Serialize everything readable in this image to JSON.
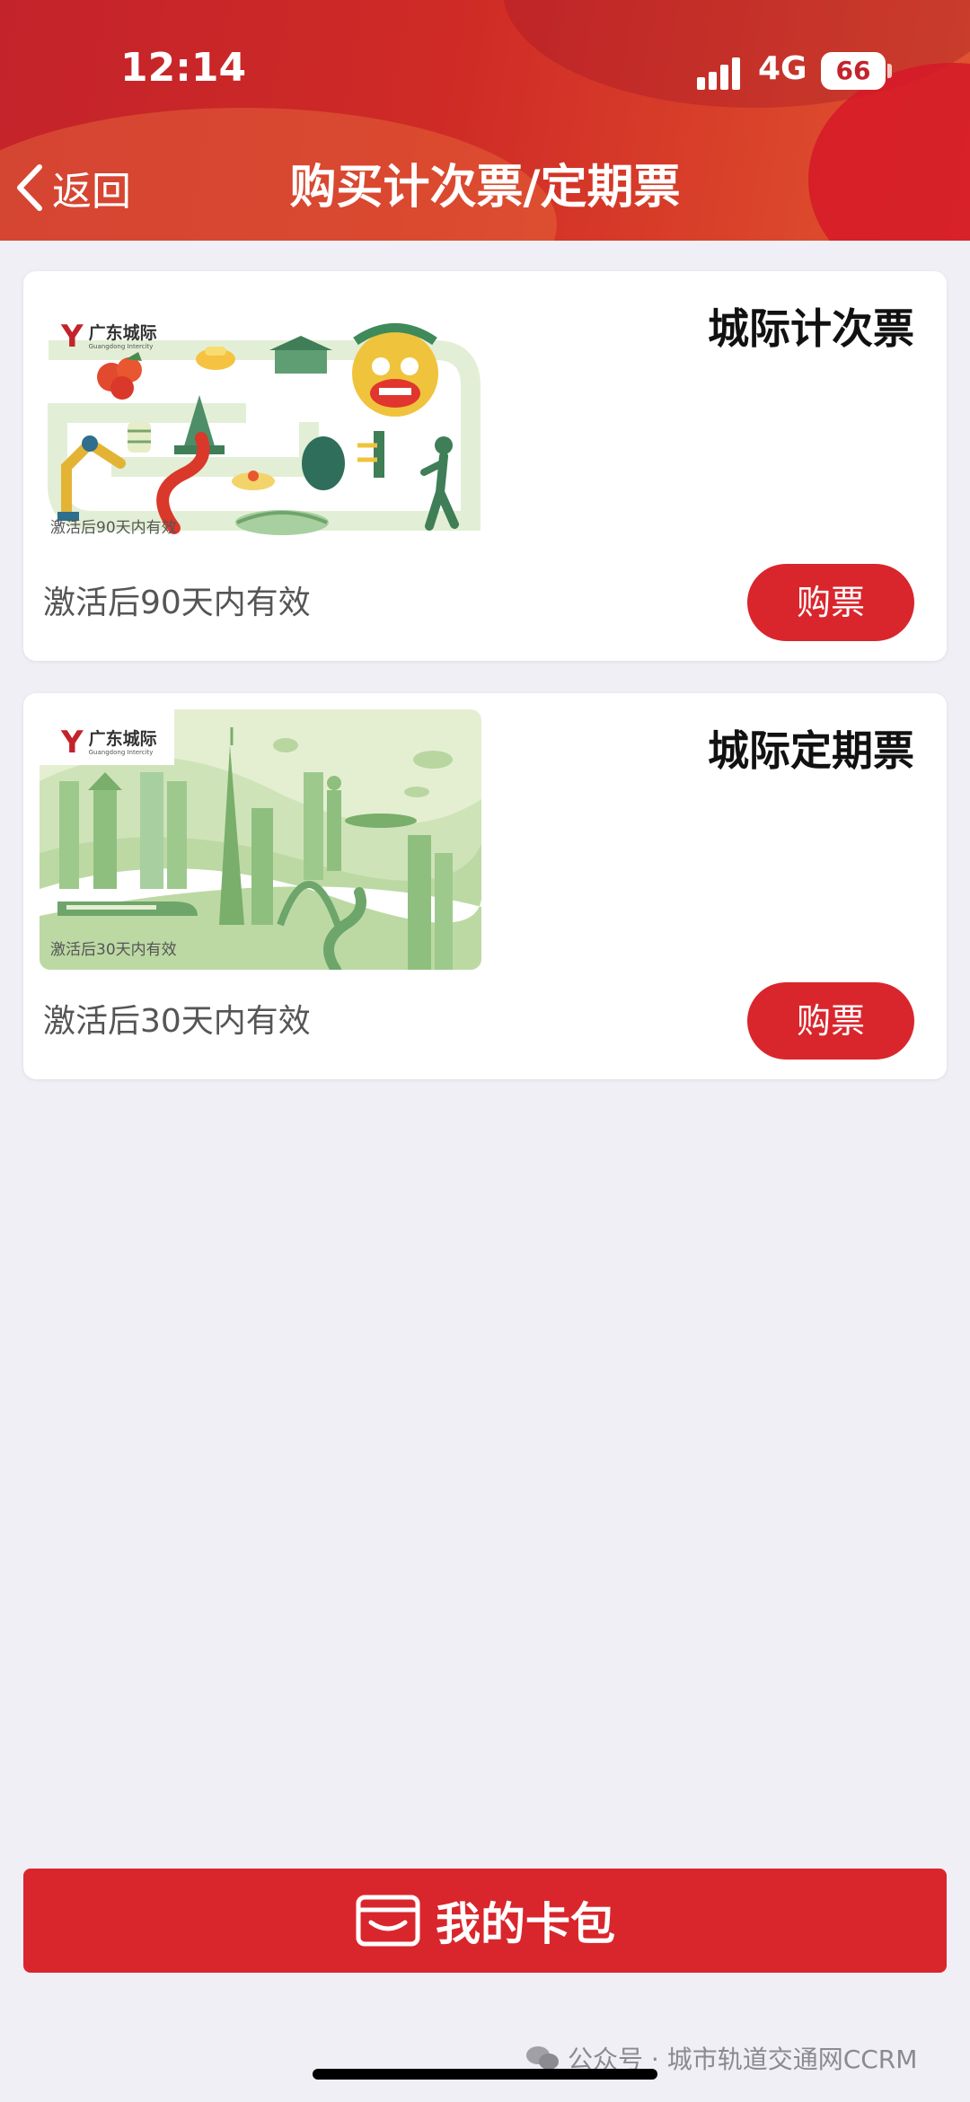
{
  "status_bar": {
    "time": "12:14",
    "network": "4G",
    "battery": "66"
  },
  "header": {
    "back_label": "返回",
    "title": "购买计次票/定期票"
  },
  "tickets": [
    {
      "name": "城际计次票",
      "validity": "激活后90天内有效",
      "art_caption": "激活后90天内有效",
      "art_logo_cn": "广东城际",
      "art_logo_en": "Guangdong Intercity",
      "buy_label": "购票"
    },
    {
      "name": "城际定期票",
      "validity": "激活后30天内有效",
      "art_caption": "激活后30天内有效",
      "art_logo_cn": "广东城际",
      "art_logo_en": "Guangdong Intercity",
      "buy_label": "购票"
    }
  ],
  "wallet_button": {
    "label": "我的卡包"
  },
  "watermark": {
    "text": "公众号 · 城市轨道交通网CCRM"
  },
  "colors": {
    "header_red": "#c3232b",
    "button_red": "#d9262c",
    "page_bg": "#f0eff5",
    "art_green": "#8fbf7f"
  },
  "icons": [
    "back-chevron-icon",
    "signal-icon",
    "battery-icon",
    "wallet-card-icon",
    "wechat-icon"
  ]
}
